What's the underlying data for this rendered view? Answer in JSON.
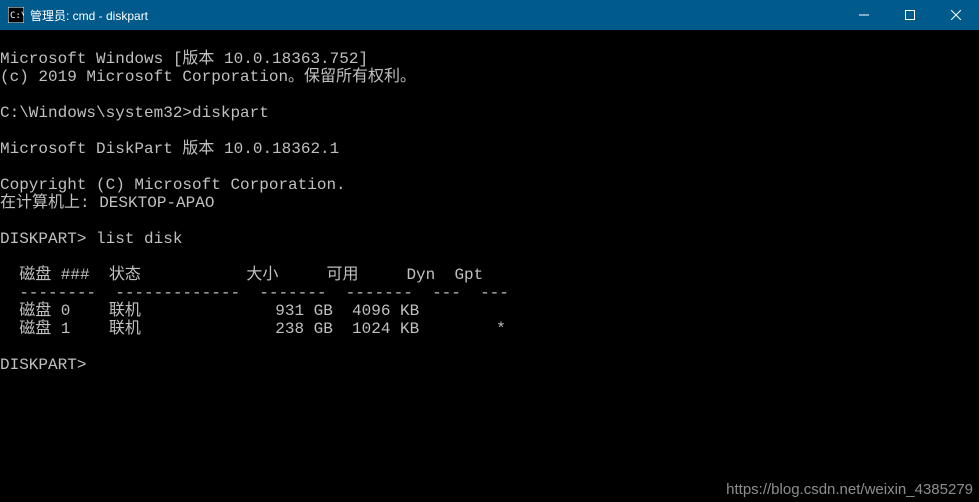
{
  "titlebar": {
    "title": "管理员: cmd - diskpart"
  },
  "term": {
    "line1": "Microsoft Windows [版本 10.0.18363.752]",
    "line2": "(c) 2019 Microsoft Corporation。保留所有权利。",
    "prompt1": "C:\\Windows\\system32>diskpart",
    "dpver": "Microsoft DiskPart 版本 10.0.18362.1",
    "copyright": "Copyright (C) Microsoft Corporation.",
    "computer": "在计算机上: DESKTOP-APAO",
    "dpprompt_cmd": "DISKPART> list disk",
    "header": "  磁盘 ###  状态           大小     可用     Dyn  Gpt",
    "divider": "  --------  -------------  -------  -------  ---  ---",
    "row0": "  磁盘 0    联机              931 GB  4096 KB",
    "row1": "  磁盘 1    联机              238 GB  1024 KB        *",
    "dpprompt_empty": "DISKPART>"
  },
  "watermark": "https://blog.csdn.net/weixin_4385279",
  "chart_data": {
    "type": "table",
    "title": "DISKPART list disk",
    "columns": [
      "磁盘 ###",
      "状态",
      "大小",
      "可用",
      "Dyn",
      "Gpt"
    ],
    "rows": [
      {
        "磁盘 ###": "磁盘 0",
        "状态": "联机",
        "大小": "931 GB",
        "可用": "4096 KB",
        "Dyn": "",
        "Gpt": ""
      },
      {
        "磁盘 ###": "磁盘 1",
        "状态": "联机",
        "大小": "238 GB",
        "可用": "1024 KB",
        "Dyn": "",
        "Gpt": "*"
      }
    ]
  }
}
